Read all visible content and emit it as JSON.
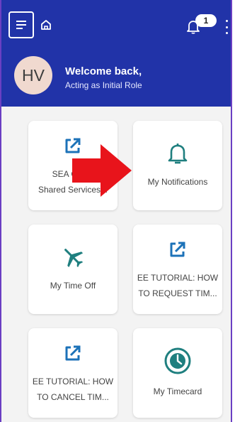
{
  "header": {
    "badge_count": "1",
    "avatar_initials": "HV",
    "welcome": "Welcome back,",
    "role": "Acting as Initial Role"
  },
  "tiles": [
    {
      "label_line1": "SEA Cha...",
      "label_line2": "Shared Services...",
      "icon": "external-link-icon"
    },
    {
      "label_line1": "My Notifications",
      "label_line2": "",
      "icon": "bell-icon"
    },
    {
      "label_line1": "My Time Off",
      "label_line2": "",
      "icon": "airplane-icon"
    },
    {
      "label_line1": "EE TUTORIAL: HOW",
      "label_line2": "TO REQUEST TIM...",
      "icon": "external-link-icon"
    },
    {
      "label_line1": "EE TUTORIAL: HOW",
      "label_line2": "TO CANCEL TIM...",
      "icon": "external-link-icon"
    },
    {
      "label_line1": "My Timecard",
      "label_line2": "",
      "icon": "clock-icon"
    }
  ],
  "colors": {
    "header_bg": "#2133a8",
    "accent_teal": "#1f7f7f",
    "link_blue": "#1c72b8",
    "annotation_red": "#e8141b"
  }
}
